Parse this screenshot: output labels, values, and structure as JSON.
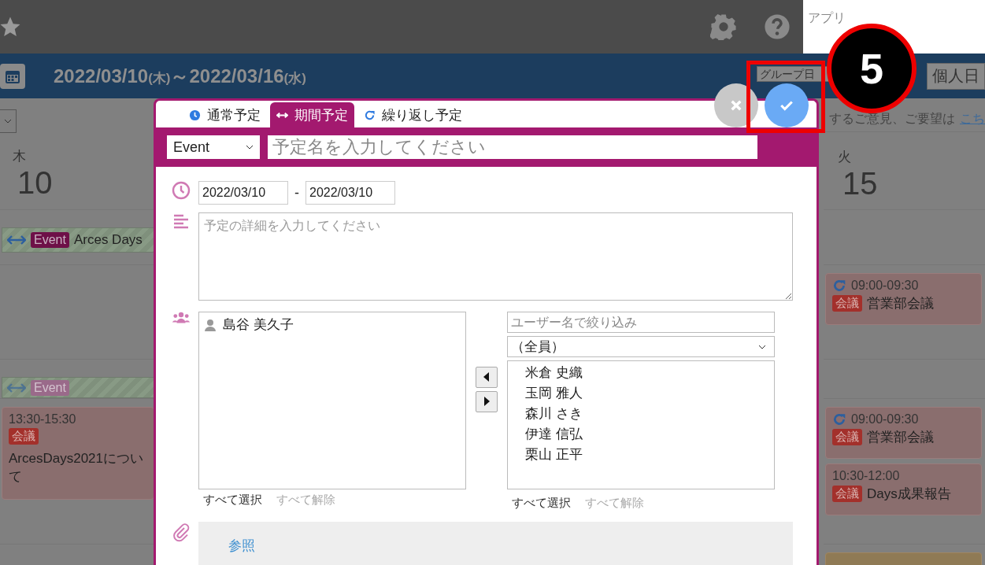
{
  "topbar": {
    "search_placeholder": "アプリ"
  },
  "header": {
    "date_start": "2022/03/10",
    "start_weekday": "(木)",
    "separator": "～",
    "date_end": "2022/03/16",
    "end_weekday": "(水)",
    "view_buttons": [
      "グループ日",
      "個人日"
    ]
  },
  "notice": {
    "text": "するご意見、ご要望は",
    "link": "こち"
  },
  "days": [
    {
      "weekday": "木",
      "day": "10",
      "rows": [
        [
          {
            "kind": "span",
            "tag": "Event",
            "title": "Arces Days",
            "faded": false
          }
        ],
        [],
        [
          {
            "kind": "span",
            "tag": "Event",
            "faded": true
          }
        ],
        [
          {
            "kind": "timed",
            "repeat": false,
            "time": "13:30-15:30",
            "tag": "会議",
            "title": "ArcesDays2021について"
          }
        ]
      ]
    },
    {
      "weekday": "火",
      "day": "15",
      "rows": [
        [],
        [
          {
            "kind": "timed",
            "repeat": true,
            "time": "09:00-09:30",
            "tag": "会議",
            "title": "営業部会議"
          }
        ],
        [],
        [
          {
            "kind": "timed",
            "repeat": true,
            "time": "09:00-09:30",
            "tag": "会議",
            "title": "営業部会議"
          },
          {
            "kind": "timed",
            "repeat": false,
            "time": "10:30-12:00",
            "tag": "会議",
            "title": "Days成果報告"
          }
        ],
        [
          {
            "kind": "deadline"
          }
        ]
      ]
    }
  ],
  "dialog": {
    "tabs": [
      {
        "label": "通常予定",
        "selected": false
      },
      {
        "label": "期間予定",
        "selected": true
      },
      {
        "label": "繰り返し予定",
        "selected": false
      }
    ],
    "category": "Event",
    "title_placeholder": "予定名を入力してください",
    "start_date": "2022/03/10",
    "date_separator": "-",
    "end_date": "2022/03/10",
    "detail_placeholder": "予定の詳細を入力してください",
    "participants": [
      "島谷 美久子"
    ],
    "participant_links": {
      "select_all": "すべて選択",
      "deselect_all": "すべて解除"
    },
    "user_filter_placeholder": "ユーザー名で絞り込み",
    "group": "（全員）",
    "candidates": [
      "米倉 史織",
      "玉岡 雅人",
      "森川 さき",
      "伊達 信弘",
      "栗山 正平"
    ],
    "candidate_links": {
      "select_all": "すべて選択",
      "deselect_all": "すべて解除"
    },
    "attach_button": "参照"
  },
  "annotation": {
    "step": "5"
  }
}
